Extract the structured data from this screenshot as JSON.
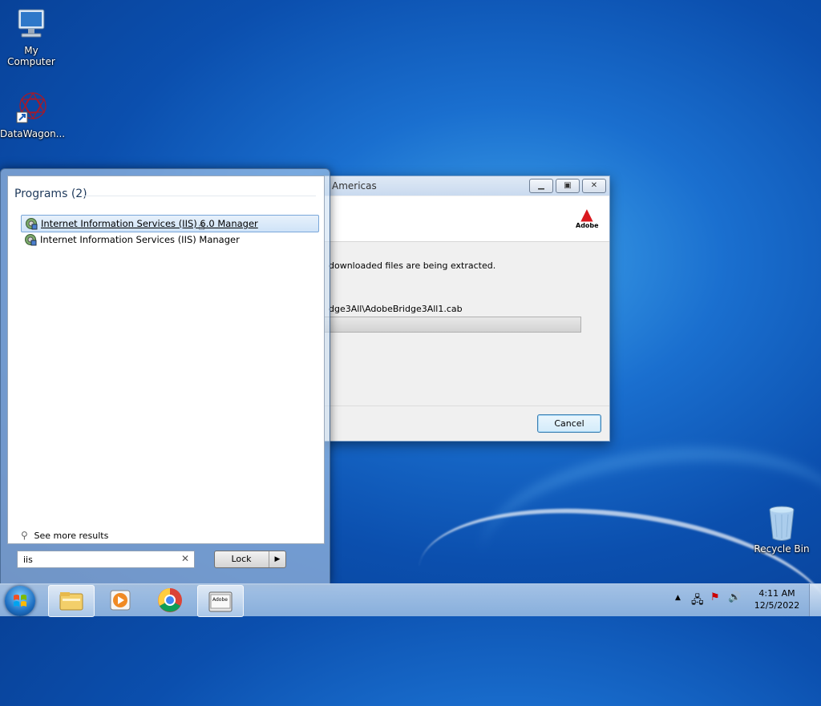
{
  "desktop": {
    "icons": [
      {
        "label": "My Computer"
      },
      {
        "label": "DataWagon..."
      },
      {
        "label": "Recycle Bin"
      }
    ]
  },
  "dialog": {
    "title": "Americas",
    "brand": "Adobe",
    "message": "downloaded files are being extracted.",
    "file_path": "dge3All\\AdobeBridge3All1.cab",
    "progress": 0.0,
    "cancel_label": "Cancel"
  },
  "start_menu": {
    "section_heading": "Programs (2)",
    "programs": [
      {
        "label": "Internet Information Services (IIS) 6.0 Manager",
        "highlighted": true
      },
      {
        "label": "Internet Information Services (IIS) Manager",
        "highlighted": false
      }
    ],
    "see_more": "See more results",
    "search": {
      "value": "iis"
    },
    "power_button": "Lock"
  },
  "taskbar": {
    "pinned": [
      {
        "icon": "windows-explorer-icon",
        "active": true
      },
      {
        "icon": "media-player-icon",
        "active": false
      },
      {
        "icon": "chrome-icon",
        "active": false
      },
      {
        "icon": "adobe-installer-icon",
        "active": true,
        "label": "Adobe"
      }
    ],
    "clock": {
      "time": "4:11 AM",
      "date": "12/5/2022"
    }
  },
  "colors": {
    "adobe_red": "#d9191f",
    "highlight_border": "#7aa7d9"
  }
}
